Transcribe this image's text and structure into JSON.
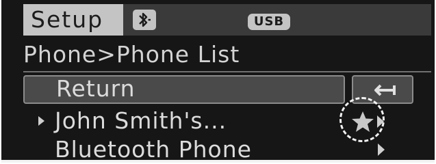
{
  "header": {
    "title": "Setup",
    "bluetooth_icon": "bluetooth-icon",
    "usb_badge": "USB"
  },
  "breadcrumb": "Phone>Phone List",
  "list": {
    "items": [
      {
        "label": "Return",
        "selected": true
      },
      {
        "label": "John Smith's...",
        "selected": false,
        "current": true,
        "favorite": true
      },
      {
        "label": "Bluetooth Phone",
        "selected": false
      }
    ]
  },
  "icons": {
    "back": "back-arrow-icon",
    "favorite": "star-icon",
    "more": "arrow-right-icon"
  },
  "colors": {
    "screen_bg": "#161616",
    "header_bg": "#3a3a3a",
    "title_bg": "#c4c4c4",
    "selected_bg": "#4a4a4a",
    "text": "#dcdcdc"
  }
}
